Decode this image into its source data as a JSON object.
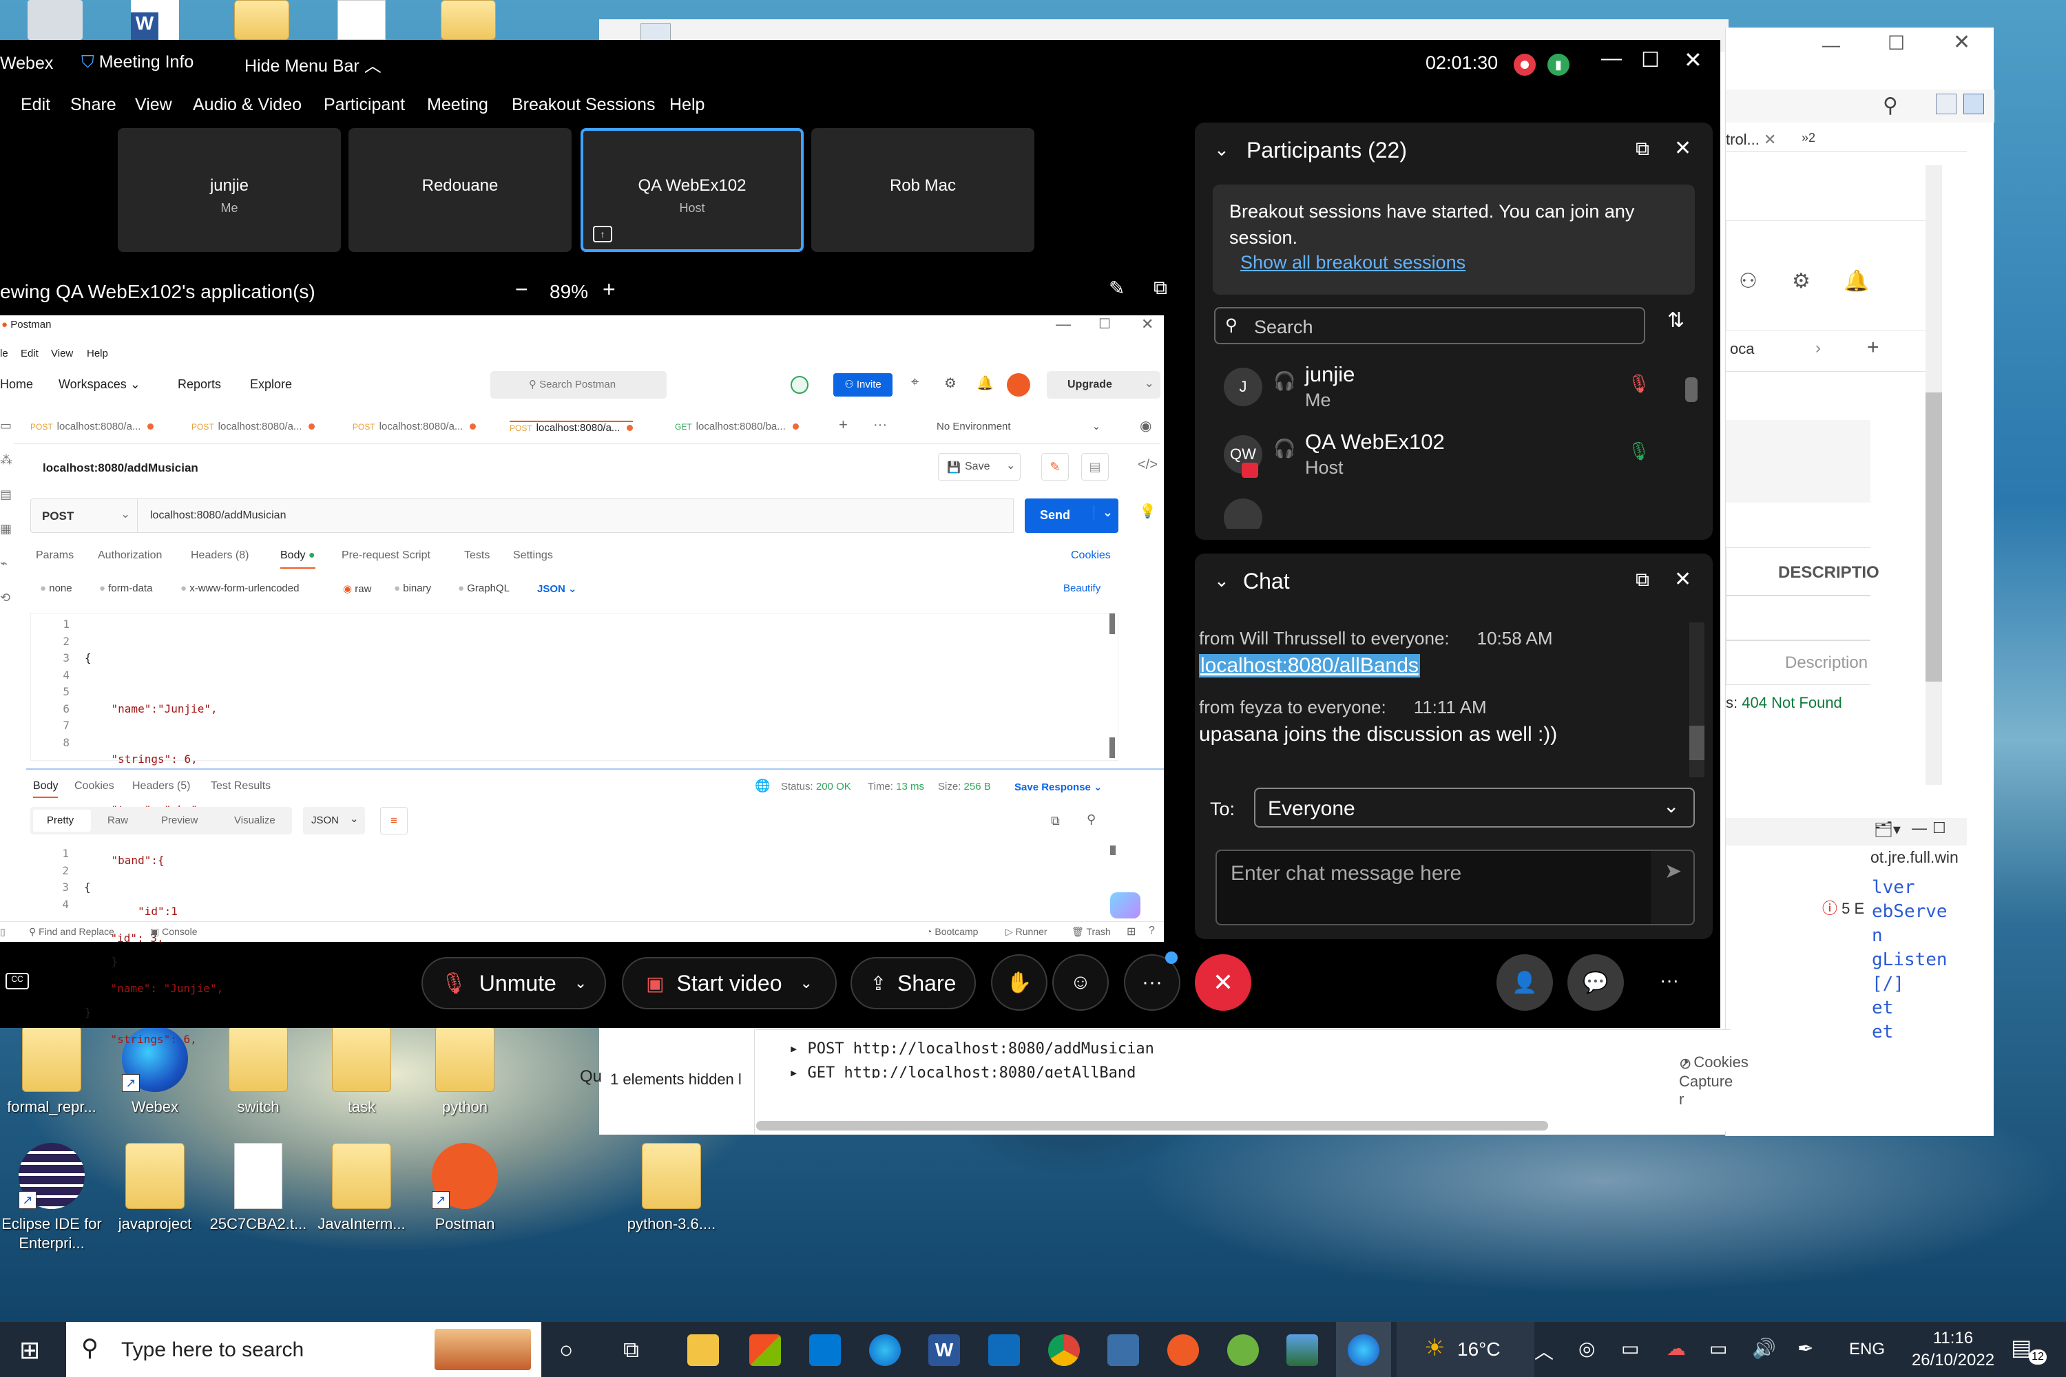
{
  "desktop": {
    "icons_row1": [
      {
        "label": "formal_repr...",
        "kind": "folder"
      },
      {
        "label": "Webex",
        "kind": "app"
      },
      {
        "label": "switch",
        "kind": "folder"
      },
      {
        "label": "task",
        "kind": "folder"
      },
      {
        "label": "python",
        "kind": "folder"
      }
    ],
    "icons_row2": [
      {
        "label": "Eclipse IDE for Enterpri...",
        "kind": "app"
      },
      {
        "label": "javaproject",
        "kind": "folder"
      },
      {
        "label": "25C7CBA2.t...",
        "kind": "file"
      },
      {
        "label": "JavaInterm...",
        "kind": "folder"
      },
      {
        "label": "Postman",
        "kind": "app"
      },
      {
        "label": "python-3.6....",
        "kind": "folder"
      }
    ]
  },
  "background_windows": {
    "eclipse_tab_label": "trol...",
    "overflow_count": "2",
    "description_header": "DESCRIPTIO",
    "description_placeholder": "Description",
    "error_label": "404 Not Found",
    "error_prefix": "s:",
    "jre_label": "ot.jre.full.win",
    "error_count": "5 E",
    "code_fragments": [
      "lver",
      "ebServe",
      "n",
      "gListen",
      "[/]",
      "et",
      "et"
    ],
    "tab_cut_label": "oca",
    "console_lines": [
      "POST http://localhost:8080/addMusician",
      "GET http://localhost:8080/getAllBand"
    ],
    "hidden_elements": "1 elements hidden l",
    "qu_label": "Qu",
    "cookies_label": "Cookies",
    "capture_label": "Capture r"
  },
  "webex": {
    "app_name": "Webex",
    "meeting_info": "Meeting Info",
    "hide_menu_bar": "Hide Menu Bar",
    "timer": "02:01:30",
    "menu": [
      "Edit",
      "Share",
      "View",
      "Audio & Video",
      "Participant",
      "Meeting",
      "Breakout Sessions",
      "Help"
    ],
    "tiles": [
      {
        "name": "junjie",
        "role": "Me"
      },
      {
        "name": "Redouane",
        "role": ""
      },
      {
        "name": "QA WebEx102",
        "role": "Host"
      },
      {
        "name": "Rob Mac",
        "role": ""
      }
    ],
    "viewing_label": "ewing QA WebEx102's application(s)",
    "zoom": "89%",
    "controls": {
      "unmute": "Unmute",
      "start_video": "Start video",
      "share": "Share",
      "more": "···"
    },
    "participants": {
      "title": "Participants (22)",
      "breakout_notice": "Breakout sessions have started. You can join any session.",
      "breakout_link": "Show all breakout sessions",
      "search_placeholder": "Search",
      "list": [
        {
          "initials": "J",
          "name": "junjie",
          "role": "Me",
          "muted": true
        },
        {
          "initials": "QW",
          "name": "QA WebEx102",
          "role": "Host",
          "muted": false
        }
      ]
    },
    "chat": {
      "title": "Chat",
      "messages": [
        {
          "from": "from Will Thrussell to everyone:",
          "time": "10:58 AM",
          "text": "localhost:8080/allBands"
        },
        {
          "from": "from feyza to everyone:",
          "time": "11:11 AM",
          "text": "upasana joins the discussion as well :))"
        }
      ],
      "to_label": "To:",
      "to_value": "Everyone",
      "input_placeholder": "Enter chat message here"
    }
  },
  "postman": {
    "title": "Postman",
    "menu": [
      "le",
      "Edit",
      "View",
      "Help"
    ],
    "nav": [
      "Home",
      "Workspaces",
      "Reports",
      "Explore"
    ],
    "search_placeholder": "Search Postman",
    "invite": "Invite",
    "upgrade": "Upgrade",
    "tabs": [
      {
        "method": "POST",
        "url": "localhost:8080/a..."
      },
      {
        "method": "POST",
        "url": "localhost:8080/a..."
      },
      {
        "method": "POST",
        "url": "localhost:8080/a..."
      },
      {
        "method": "POST",
        "url": "localhost:8080/a..."
      },
      {
        "method": "GET",
        "url": "localhost:8080/ba..."
      }
    ],
    "environment": "No Environment",
    "request_title": "localhost:8080/addMusician",
    "save": "Save",
    "method": "POST",
    "url": "localhost:8080/addMusician",
    "send": "Send",
    "req_tabs": [
      "Params",
      "Authorization",
      "Headers (8)",
      "Body",
      "Pre-request Script",
      "Tests",
      "Settings"
    ],
    "cookies": "Cookies",
    "body_types": [
      "none",
      "form-data",
      "x-www-form-urlencoded",
      "raw",
      "binary",
      "GraphQL"
    ],
    "body_format": "JSON",
    "beautify": "Beautify",
    "request_lines": [
      "{",
      "    \"name\":\"Junjie\",",
      "    \"strings\": 6,",
      "    \"type\": \"abc\",",
      "    \"band\":{",
      "        \"id\":1",
      "    }",
      "}"
    ],
    "resp_tabs": [
      "Body",
      "Cookies",
      "Headers (5)",
      "Test Results"
    ],
    "status_label": "Status:",
    "status": "200 OK",
    "time_label": "Time:",
    "time": "13 ms",
    "size_label": "Size:",
    "size": "256 B",
    "save_response": "Save Response",
    "view_modes": [
      "Pretty",
      "Raw",
      "Preview",
      "Visualize"
    ],
    "resp_format": "JSON",
    "response_lines": [
      "{",
      "    \"id\": 3,",
      "    \"name\": \"Junjie\",",
      "    \"strings\": 6,"
    ],
    "footer_left": [
      "Find and Replace",
      "Console"
    ],
    "footer_right": [
      "Bootcamp",
      "Runner",
      "Trash"
    ]
  },
  "taskbar": {
    "search_placeholder": "Type here to search",
    "weather": "16°C",
    "language": "ENG",
    "time": "11:16",
    "date": "26/10/2022",
    "notifications": "12"
  }
}
